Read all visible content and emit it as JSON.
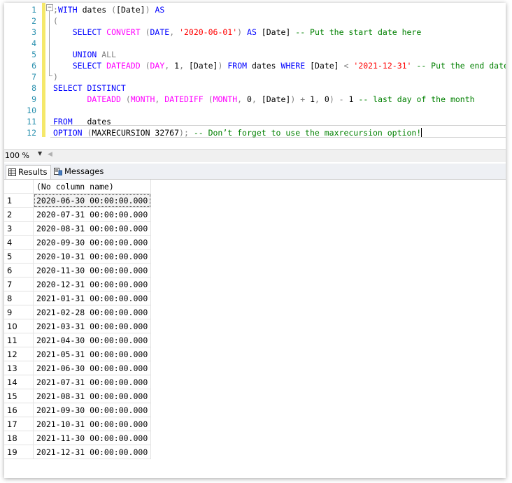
{
  "editor": {
    "line_numbers": [
      "1",
      "2",
      "3",
      "4",
      "5",
      "6",
      "7",
      "8",
      "9",
      "10",
      "11",
      "12"
    ],
    "lines": [
      [
        {
          "t": ";",
          "c": "gr"
        },
        {
          "t": "WITH",
          "c": "kw"
        },
        {
          "t": " dates ",
          "c": ""
        },
        {
          "t": "(",
          "c": "gr"
        },
        {
          "t": "[Date]",
          "c": ""
        },
        {
          "t": ")",
          "c": "gr"
        },
        {
          "t": " AS",
          "c": "kw"
        }
      ],
      [
        {
          "t": "(",
          "c": "gr"
        }
      ],
      [
        {
          "t": "    SELECT ",
          "c": "kw"
        },
        {
          "t": "CONVERT",
          "c": "fn"
        },
        {
          "t": " (",
          "c": "gr"
        },
        {
          "t": "DATE",
          "c": "kw"
        },
        {
          "t": ", ",
          "c": "gr"
        },
        {
          "t": "'2020-06-01'",
          "c": "str"
        },
        {
          "t": ")",
          "c": "gr"
        },
        {
          "t": " AS ",
          "c": "kw"
        },
        {
          "t": "[Date]",
          "c": ""
        },
        {
          "t": " -- Put the start date here",
          "c": "cm"
        }
      ],
      [
        {
          "t": "",
          "c": ""
        }
      ],
      [
        {
          "t": "    UNION",
          "c": "kw"
        },
        {
          "t": " ALL",
          "c": "gr"
        }
      ],
      [
        {
          "t": "    SELECT ",
          "c": "kw"
        },
        {
          "t": "DATEADD",
          "c": "fn"
        },
        {
          "t": " (",
          "c": "gr"
        },
        {
          "t": "DAY",
          "c": "fn"
        },
        {
          "t": ", ",
          "c": "gr"
        },
        {
          "t": "1",
          "c": ""
        },
        {
          "t": ", ",
          "c": "gr"
        },
        {
          "t": "[Date]",
          "c": ""
        },
        {
          "t": ")",
          "c": "gr"
        },
        {
          "t": " FROM",
          "c": "kw"
        },
        {
          "t": " dates ",
          "c": ""
        },
        {
          "t": "WHERE",
          "c": "kw"
        },
        {
          "t": " [Date] ",
          "c": ""
        },
        {
          "t": "<",
          "c": "gr"
        },
        {
          "t": " '2021-12-31'",
          "c": "str"
        },
        {
          "t": " -- Put the end date here",
          "c": "cm"
        }
      ],
      [
        {
          "t": ")",
          "c": "gr"
        }
      ],
      [
        {
          "t": "SELECT DISTINCT",
          "c": "kw"
        }
      ],
      [
        {
          "t": "       ",
          "c": ""
        },
        {
          "t": "DATEADD",
          "c": "fn"
        },
        {
          "t": " (",
          "c": "gr"
        },
        {
          "t": "MONTH",
          "c": "fn"
        },
        {
          "t": ", ",
          "c": "gr"
        },
        {
          "t": "DATEDIFF",
          "c": "fn"
        },
        {
          "t": " (",
          "c": "gr"
        },
        {
          "t": "MONTH",
          "c": "fn"
        },
        {
          "t": ", ",
          "c": "gr"
        },
        {
          "t": "0",
          "c": ""
        },
        {
          "t": ", ",
          "c": "gr"
        },
        {
          "t": "[Date]",
          "c": ""
        },
        {
          "t": ")",
          "c": "gr"
        },
        {
          "t": " + ",
          "c": "gr"
        },
        {
          "t": "1",
          "c": ""
        },
        {
          "t": ", ",
          "c": "gr"
        },
        {
          "t": "0",
          "c": ""
        },
        {
          "t": ")",
          "c": "gr"
        },
        {
          "t": " - ",
          "c": "gr"
        },
        {
          "t": "1",
          "c": ""
        },
        {
          "t": " -- last day of the month",
          "c": "cm"
        }
      ],
      [
        {
          "t": "",
          "c": ""
        }
      ],
      [
        {
          "t": "FROM",
          "c": "kw"
        },
        {
          "t": "   dates",
          "c": ""
        }
      ],
      [
        {
          "t": "OPTION",
          "c": "kw"
        },
        {
          "t": " (",
          "c": "gr"
        },
        {
          "t": "MAXRECURSION 32767",
          "c": ""
        },
        {
          "t": ");",
          "c": "gr"
        },
        {
          "t": " -- Don’t forget to use the maxrecursion option!",
          "c": "cm"
        }
      ]
    ]
  },
  "status": {
    "zoom": "100 %"
  },
  "tabs": [
    {
      "label": "Results",
      "icon": "grid-icon",
      "active": true
    },
    {
      "label": "Messages",
      "icon": "messages-icon",
      "active": false
    }
  ],
  "results": {
    "column_header": "(No column name)",
    "rows": [
      [
        "1",
        "2020-06-30 00:00:00.000"
      ],
      [
        "2",
        "2020-07-31 00:00:00.000"
      ],
      [
        "3",
        "2020-08-31 00:00:00.000"
      ],
      [
        "4",
        "2020-09-30 00:00:00.000"
      ],
      [
        "5",
        "2020-10-31 00:00:00.000"
      ],
      [
        "6",
        "2020-11-30 00:00:00.000"
      ],
      [
        "7",
        "2020-12-31 00:00:00.000"
      ],
      [
        "8",
        "2021-01-31 00:00:00.000"
      ],
      [
        "9",
        "2021-02-28 00:00:00.000"
      ],
      [
        "10",
        "2021-03-31 00:00:00.000"
      ],
      [
        "11",
        "2021-04-30 00:00:00.000"
      ],
      [
        "12",
        "2021-05-31 00:00:00.000"
      ],
      [
        "13",
        "2021-06-30 00:00:00.000"
      ],
      [
        "14",
        "2021-07-31 00:00:00.000"
      ],
      [
        "15",
        "2021-08-31 00:00:00.000"
      ],
      [
        "16",
        "2021-09-30 00:00:00.000"
      ],
      [
        "17",
        "2021-10-31 00:00:00.000"
      ],
      [
        "18",
        "2021-11-30 00:00:00.000"
      ],
      [
        "19",
        "2021-12-31 00:00:00.000"
      ]
    ]
  }
}
